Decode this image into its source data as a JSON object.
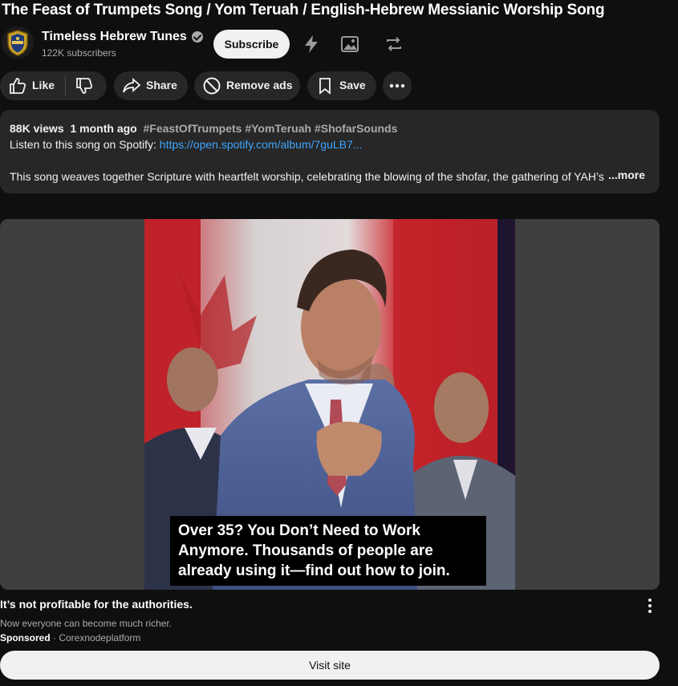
{
  "video": {
    "title": "The Feast of Trumpets Song / Yom Teruah / English-Hebrew Messianic Worship Song"
  },
  "channel": {
    "name": "Timeless Hebrew Tunes",
    "subscribers": "122K subscribers",
    "subscribe_label": "Subscribe"
  },
  "actions": {
    "like_label": "Like",
    "share_label": "Share",
    "remove_ads_label": "Remove ads",
    "save_label": "Save"
  },
  "description": {
    "views": "88K views",
    "age": "1 month ago",
    "hashtags": "#FeastOfTrumpets #YomTeruah #ShofarSounds",
    "spotify_prefix": "Listen to this song on Spotify: ",
    "spotify_link": "https://open.spotify.com/album/7guLB7...",
    "body": "This song weaves together Scripture with heartfelt worship, celebrating the blowing of the shofar, the gathering of YAH’s",
    "more_label": "...more"
  },
  "ad": {
    "caption": "Over 35? You Don’t Need to Work Anymore. Thousands of people are already using it—find out how to join.",
    "title": "It’s not profitable for the authorities.",
    "subtitle": "Now everyone can become much richer.",
    "sponsored_label": "Sponsored",
    "advertiser": "Corexnodeplatform",
    "visit_label": "Visit site"
  },
  "icons": [
    "verified-icon",
    "lightning-icon",
    "image-icon",
    "repeat-icon",
    "thumbs-up-icon",
    "thumbs-down-icon",
    "share-icon",
    "no-ads-icon",
    "bookmark-icon",
    "more-horizontal-icon",
    "more-vertical-icon"
  ],
  "colors": {
    "background": "#0f0f0f",
    "surface": "#272727",
    "link": "#3ea6ff",
    "subscribe_bg": "#f1f1f1"
  }
}
